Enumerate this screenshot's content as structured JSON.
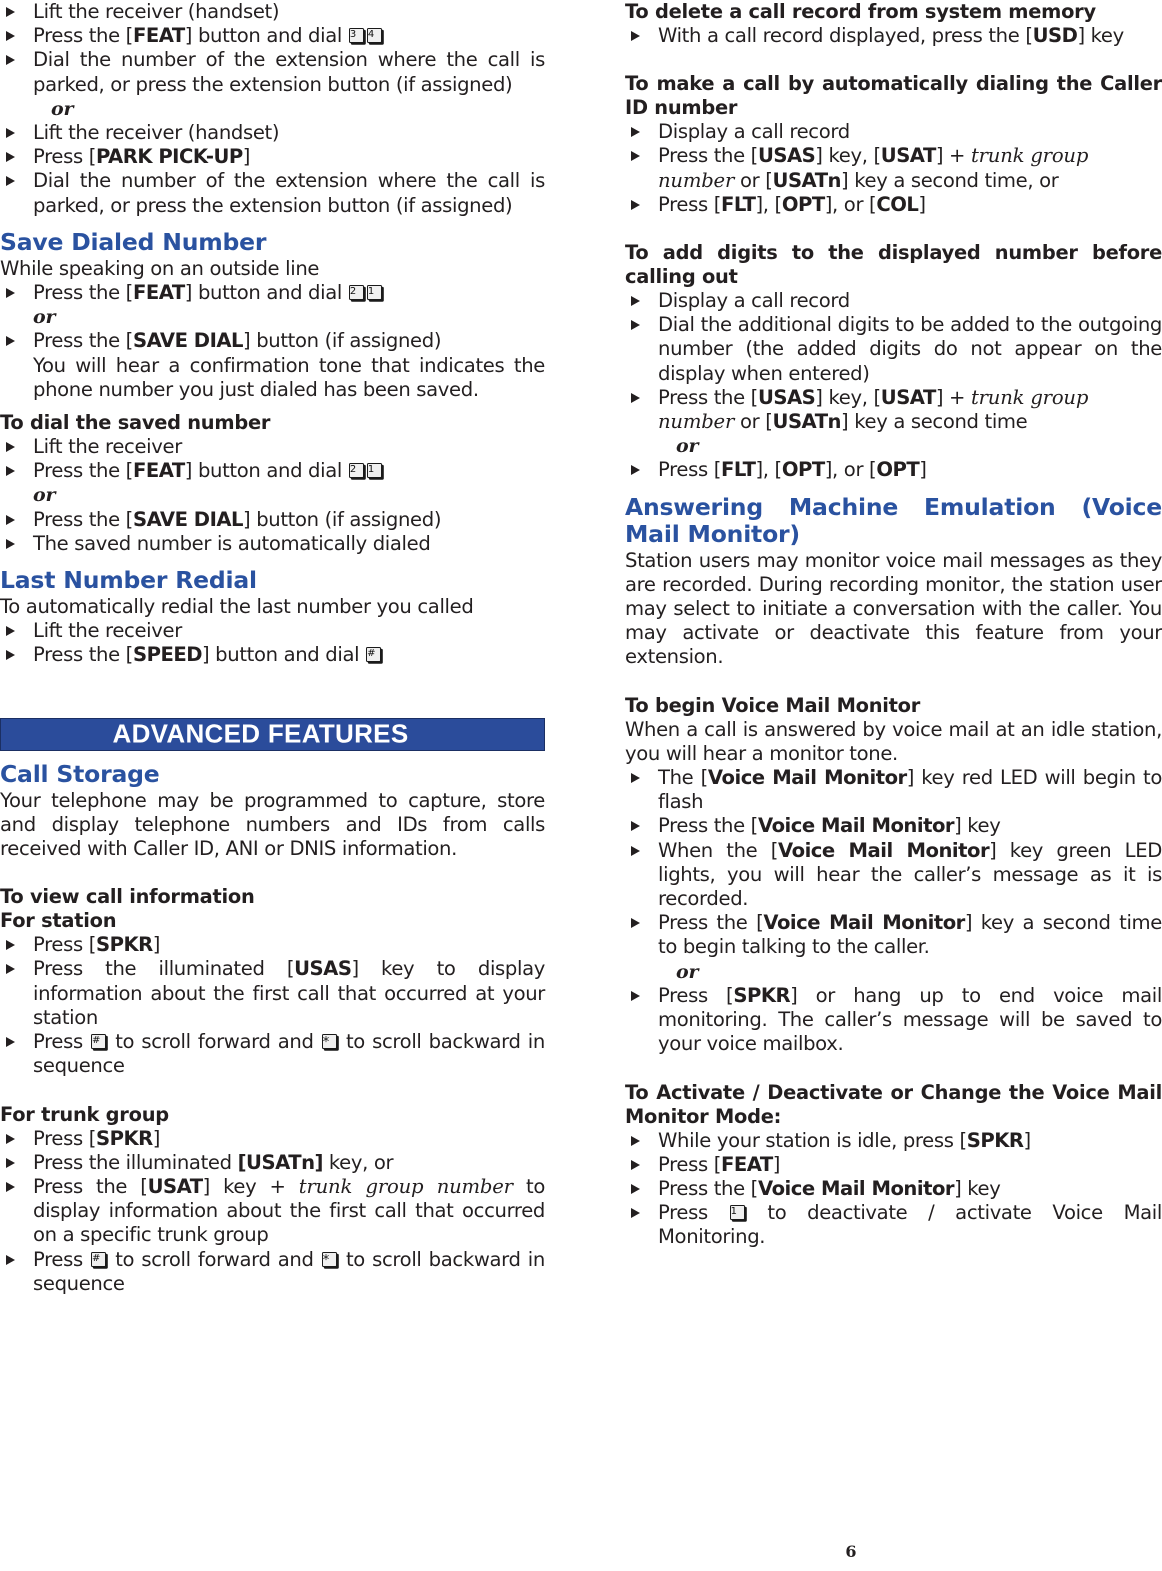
{
  "page": {
    "number": "6",
    "banner_label": "ADVANCED FEATURES",
    "heading_color": "#2a52a0",
    "banner_color": "#2b4c9b",
    "text_color": "#231f20"
  },
  "left_column": {
    "park_pickup": {
      "steps": [
        "Lift the receiver (handset)",
        "Press the [FEAT] button and dial",
        "Dial the number of the extension where the call is parked, or press the extension button (if assigned)",
        "or",
        "Lift the receiver (handset)",
        "Press [PARK PICK-UP]",
        "Dial the number of the extension where the call is parked, or press the extension button (if assigned)"
      ],
      "keys_feat": [
        "3",
        "4"
      ],
      "key_names": [
        "FEAT",
        "PARK PICK-UP"
      ]
    },
    "save_dialed_number": {
      "heading": "Save Dialed Number",
      "intro": "While speaking on an outside line",
      "step1_pre": "Press the [",
      "step1_key": "FEAT",
      "step1_post": "]  button and dial",
      "step1_digits": [
        "2",
        "1"
      ],
      "or": "or",
      "step2_pre": "Press the [",
      "step2_key": "SAVE DIAL",
      "step2_post": "] button (if assigned)",
      "step2_note": "You will hear a confirmation tone that indicates the phone number you just dialed has been saved.",
      "sub_heading": "To dial the saved number",
      "sub_steps": [
        "Lift the receiver",
        "Press the [FEAT] button  and dial",
        "or",
        "Press the [SAVE DIAL] button (if assigned)",
        "The saved number is automatically dialed"
      ],
      "sub_digits": [
        "2",
        "1"
      ]
    },
    "last_number_redial": {
      "heading": "Last Number Redial",
      "intro": "To automatically redial the last number you called",
      "step1": "Lift the receiver",
      "step2_pre": "Press the [",
      "step2_key": "SPEED",
      "step2_post": "] button and dial",
      "step2_keycap": "#"
    },
    "call_storage": {
      "heading": "Call Storage",
      "intro": "Your telephone may be programmed to capture, store and display telephone numbers and IDs from calls received with Caller ID, ANI or DNIS information.",
      "view_heading": "To view  call information",
      "station_heading": "For  station",
      "station_step1_pre": "Press [",
      "station_step1_key": "SPKR",
      "station_step1_post": "]",
      "station_step2_pre": "Press the illuminated [",
      "station_step2_key": "USAS",
      "station_step2_post": "] key to display information about the first call that occurred at your station",
      "scroll_pre": "Press",
      "scroll_mid": "to scroll forward and",
      "scroll_post": "to scroll backward in sequence",
      "scroll_fwd_key": "#",
      "scroll_back_key": "*",
      "trunk_heading": "For trunk group",
      "trunk_step1_pre": "Press [",
      "trunk_step1_key": "SPKR",
      "trunk_step1_post": "]",
      "trunk_step2_pre": "Press the illuminated ",
      "trunk_step2_key": "[USATn]",
      "trunk_step2_post": " key, or",
      "trunk_step3_pre": "Press the [",
      "trunk_step3_key": "USAT",
      "trunk_step3_mid": "] key + ",
      "trunk_step3_italic": "trunk group number",
      "trunk_step3_post": " to display information about the first call that occurred on a specific trunk group"
    }
  },
  "right_column": {
    "delete_record": {
      "heading": "To delete a call record from system memory",
      "step_pre": "With a call record displayed, press the [",
      "step_key": "USD",
      "step_post": "] key"
    },
    "auto_dial_caller_id": {
      "heading": "To make a call by automatically dialing the Caller ID number",
      "step1": "Display a call record",
      "step2_pre": "Press the [",
      "step2_key1": "USAS",
      "step2_mid1": "] key, [",
      "step2_key2": "USAT",
      "step2_mid2": "] + ",
      "step2_italic": "trunk group number",
      "step2_post_pre": " or [",
      "step2_key3": "USATn",
      "step2_post": "] key a second time, or",
      "step3_pre": "Press  [",
      "step3_key1": "FLT",
      "step3_mid1": "], [",
      "step3_key2": "OPT",
      "step3_mid2": "], or [",
      "step3_key3": "COL",
      "step3_post": "]"
    },
    "add_digits": {
      "heading": "To add digits to the displayed number before calling out",
      "step1": "Display a call record",
      "step2": "Dial the additional digits to be added to the outgoing number (the added digits do not appear on the display when entered)",
      "step3_pre": "Press the [",
      "step3_key1": "USAS",
      "step3_mid1": "] key, [",
      "step3_key2": "USAT",
      "step3_mid2": "] + ",
      "step3_italic": "trunk group number",
      "step3_cont_pre": " or [",
      "step3_key3": "USATn",
      "step3_cont_post": "] key a second time",
      "or": "or",
      "step4_pre": "Press  [",
      "step4_key1": "FLT",
      "step4_mid1": "], [",
      "step4_key2": "OPT",
      "step4_mid2": "], or [",
      "step4_key3": "OPT",
      "step4_post": "]"
    },
    "answering_machine": {
      "heading": "Answering Machine Emulation (Voice Mail Monitor)",
      "intro": "Station users may monitor voice mail messages as they are recorded.  During recording monitor, the station user may select to initiate a conversation with the caller.  You may activate or deactivate this feature from your extension."
    },
    "begin_vmm": {
      "heading": "To begin Voice Mail Monitor",
      "intro": "When a call is answered by voice mail at an idle station, you will hear a monitor tone.",
      "step1_pre": "The [",
      "step1_key": "Voice Mail Monitor",
      "step1_post": "] key red LED will begin to flash",
      "step2_pre": "Press the [",
      "step2_key": "Voice Mail Monitor",
      "step2_post": "] key",
      "step3_pre": "When the [",
      "step3_key": "Voice Mail Monitor",
      "step3_post": "] key green LED lights, you will hear the caller’s message as it is recorded.",
      "step4_pre": "Press the [",
      "step4_key": "Voice Mail Monitor",
      "step4_post": "] key a second time to begin talking to the caller.",
      "or": "or",
      "step5_pre": "Press [",
      "step5_key": "SPKR",
      "step5_post": "] or hang up to end voice mail monitoring.  The caller’s message will be saved to your voice mailbox."
    },
    "activate_vmm": {
      "heading": "To Activate / Deactivate or Change the Voice Mail Monitor Mode:",
      "step1_pre": "While your station is idle, press [",
      "step1_key": "SPKR",
      "step1_post": "]",
      "step2_pre": "Press [",
      "step2_key": "FEAT",
      "step2_post": "]",
      "step3_pre": "Press the [",
      "step3_key": "Voice Mail Monitor",
      "step3_post": "] key",
      "step4_pre": "Press",
      "step4_keycap": "1",
      "step4_post": "to deactivate / activate Voice Mail Monitoring."
    }
  }
}
